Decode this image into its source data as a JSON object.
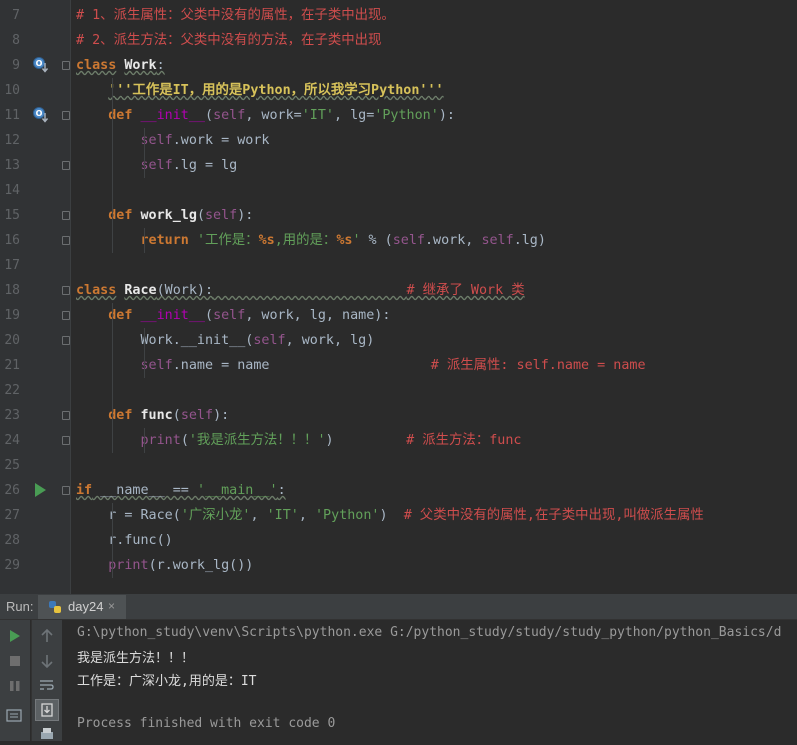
{
  "colors": {
    "editor_bg": "#2b2b2b",
    "keyword": "#cc7832",
    "string": "#6a8759",
    "comment_red": "#cf4d4d",
    "self": "#94558d",
    "magic": "#b200b2",
    "output_path": "#9a9a9a"
  },
  "editor": {
    "lines": [
      {
        "num": "7",
        "tokens": [
          {
            "t": "# 1、派生属性：父类中没有的属性，在子类中出现。",
            "c": "cm"
          }
        ]
      },
      {
        "num": "8",
        "tokens": [
          {
            "t": "# 2、派生方法：父类中没有的方法，在子类中出现",
            "c": "cm"
          }
        ]
      },
      {
        "num": "9",
        "tokens": [
          {
            "t": "class",
            "c": "k wv"
          },
          {
            "t": " "
          },
          {
            "t": "Work",
            "c": "f wv"
          },
          {
            "t": ":",
            "c": "wv"
          }
        ]
      },
      {
        "num": "10",
        "tokens": [
          {
            "t": "    "
          },
          {
            "t": "'''工作是IT，用的是Python，所以我学习Python'''",
            "c": "sb wv"
          }
        ]
      },
      {
        "num": "11",
        "tokens": [
          {
            "t": "    "
          },
          {
            "t": "def",
            "c": "k"
          },
          {
            "t": " "
          },
          {
            "t": "__init__",
            "c": "mg"
          },
          {
            "t": "("
          },
          {
            "t": "self",
            "c": "sf"
          },
          {
            "t": ", work="
          },
          {
            "t": "'IT'",
            "c": "sg"
          },
          {
            "t": ", lg="
          },
          {
            "t": "'Python'",
            "c": "sg"
          },
          {
            "t": "):"
          }
        ]
      },
      {
        "num": "12",
        "tokens": [
          {
            "t": "        "
          },
          {
            "t": "self",
            "c": "sf"
          },
          {
            "t": ".work = work"
          }
        ]
      },
      {
        "num": "13",
        "tokens": [
          {
            "t": "        "
          },
          {
            "t": "self",
            "c": "sf"
          },
          {
            "t": ".lg = lg"
          }
        ]
      },
      {
        "num": "14",
        "tokens": []
      },
      {
        "num": "15",
        "tokens": [
          {
            "t": "    "
          },
          {
            "t": "def",
            "c": "k"
          },
          {
            "t": " "
          },
          {
            "t": "work_lg",
            "c": "f"
          },
          {
            "t": "("
          },
          {
            "t": "self",
            "c": "sf"
          },
          {
            "t": "):"
          }
        ]
      },
      {
        "num": "16",
        "tokens": [
          {
            "t": "        "
          },
          {
            "t": "return",
            "c": "k"
          },
          {
            "t": " "
          },
          {
            "t": "'工作是：",
            "c": "sg"
          },
          {
            "t": "%s",
            "c": "k"
          },
          {
            "t": ",用的是：",
            "c": "sg"
          },
          {
            "t": "%s",
            "c": "k"
          },
          {
            "t": "'",
            "c": "sg"
          },
          {
            "t": " % ("
          },
          {
            "t": "self",
            "c": "sf"
          },
          {
            "t": ".work, "
          },
          {
            "t": "self",
            "c": "sf"
          },
          {
            "t": ".lg)"
          }
        ]
      },
      {
        "num": "17",
        "tokens": []
      },
      {
        "num": "18",
        "tokens": [
          {
            "t": "class",
            "c": "k wv"
          },
          {
            "t": " "
          },
          {
            "t": "Race",
            "c": "f wv"
          },
          {
            "t": "(Work):",
            "c": "wv"
          },
          {
            "t": "                        ",
            "c": "wv"
          },
          {
            "t": "# 继承了 Work 类",
            "c": "cm wv"
          }
        ]
      },
      {
        "num": "19",
        "tokens": [
          {
            "t": "    "
          },
          {
            "t": "def",
            "c": "k"
          },
          {
            "t": " "
          },
          {
            "t": "__init__",
            "c": "mg"
          },
          {
            "t": "("
          },
          {
            "t": "self",
            "c": "sf"
          },
          {
            "t": ", work, lg, name):"
          }
        ]
      },
      {
        "num": "20",
        "tokens": [
          {
            "t": "        "
          },
          {
            "t": "Work.__init__("
          },
          {
            "t": "self",
            "c": "sf"
          },
          {
            "t": ", work, lg)"
          }
        ]
      },
      {
        "num": "21",
        "tokens": [
          {
            "t": "        "
          },
          {
            "t": "self",
            "c": "sf"
          },
          {
            "t": ".name = name                    "
          },
          {
            "t": "# 派生属性: self.name = name",
            "c": "cm"
          }
        ]
      },
      {
        "num": "22",
        "tokens": []
      },
      {
        "num": "23",
        "tokens": [
          {
            "t": "    "
          },
          {
            "t": "def",
            "c": "k"
          },
          {
            "t": " "
          },
          {
            "t": "func",
            "c": "f"
          },
          {
            "t": "("
          },
          {
            "t": "self",
            "c": "sf"
          },
          {
            "t": "):"
          }
        ]
      },
      {
        "num": "24",
        "tokens": [
          {
            "t": "        "
          },
          {
            "t": "print",
            "c": "sf"
          },
          {
            "t": "("
          },
          {
            "t": "'我是派生方法！！！'",
            "c": "sg"
          },
          {
            "t": ")         "
          },
          {
            "t": "# 派生方法：func",
            "c": "cm"
          }
        ]
      },
      {
        "num": "25",
        "tokens": []
      },
      {
        "num": "26",
        "tokens": [
          {
            "t": "if",
            "c": "k wv"
          },
          {
            "t": " __name__ == ",
            "c": "wv"
          },
          {
            "t": "'__main__'",
            "c": "sg wv"
          },
          {
            "t": ":",
            "c": "wv"
          }
        ]
      },
      {
        "num": "27",
        "tokens": [
          {
            "t": "    r = Race("
          },
          {
            "t": "'广深小龙'",
            "c": "sg"
          },
          {
            "t": ", "
          },
          {
            "t": "'IT'",
            "c": "sg"
          },
          {
            "t": ", "
          },
          {
            "t": "'Python'",
            "c": "sg"
          },
          {
            "t": ")  "
          },
          {
            "t": "# 父类中没有的属性,在子类中出现,叫做派生属性",
            "c": "cm"
          }
        ]
      },
      {
        "num": "28",
        "tokens": [
          {
            "t": "    r.func()"
          }
        ]
      },
      {
        "num": "29",
        "tokens": [
          {
            "t": "    "
          },
          {
            "t": "print",
            "c": "sf"
          },
          {
            "t": "(r.work_lg())"
          }
        ]
      }
    ]
  },
  "run": {
    "label": "Run:",
    "tab_name": "day24",
    "tab_close": "×",
    "output": {
      "command": "G:\\python_study\\venv\\Scripts\\python.exe G:/python_study/study/study_python/python_Basics/d",
      "line1": "我是派生方法！！！",
      "line2": "工作是：广深小龙,用的是：IT",
      "finished": "Process finished with exit code 0"
    }
  }
}
